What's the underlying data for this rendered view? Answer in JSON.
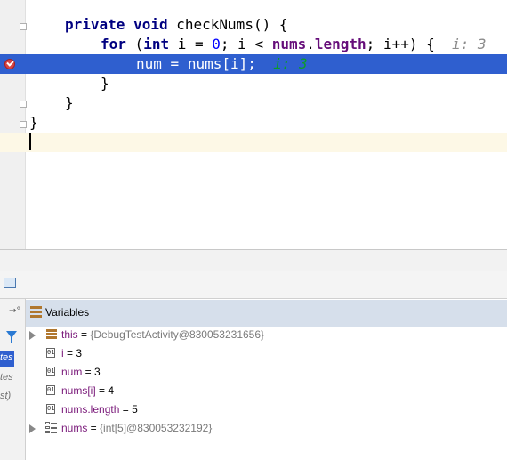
{
  "editor": {
    "lines": [
      {
        "kw1": "private",
        "kw2": "void",
        "rest": "checkNums() {"
      },
      {
        "kw1": "for",
        "open": "(",
        "kw2": "int",
        "pre": "i = ",
        "zero": "0",
        "mid": "; i < ",
        "field1": "nums",
        "dot": ".",
        "field2": "length",
        "end": "; i++) {",
        "hint": "i: 3"
      },
      {
        "field1": "num",
        "mid1": " = ",
        "field2": "nums",
        "bracket_open": "[",
        "index": "i",
        "bracket_close": "];",
        "hint": "i: 3"
      },
      {
        "text": "}"
      },
      {
        "text": "}"
      },
      {
        "text": "}"
      }
    ]
  },
  "variables_panel": {
    "title": "Variables",
    "restore_label": "→°",
    "side_labels": [
      "tes",
      "tes",
      "st)"
    ],
    "rows": [
      {
        "name": "this",
        "eq": " = ",
        "value": "{DebugTestActivity@830053231656}",
        "expandable": true,
        "icon": "object-icon"
      },
      {
        "name": "i",
        "eq": " = ",
        "value": "3",
        "expandable": false,
        "icon": "primitive-icon"
      },
      {
        "name": "num",
        "eq": " = ",
        "value": "3",
        "expandable": false,
        "icon": "primitive-icon"
      },
      {
        "name": "nums[i]",
        "eq": " = ",
        "value": "4",
        "expandable": false,
        "icon": "primitive-icon"
      },
      {
        "name": "nums.length",
        "eq": " = ",
        "value": "5",
        "expandable": false,
        "icon": "primitive-icon"
      },
      {
        "name": "nums",
        "eq": " = ",
        "value": "{int[5]@830053232192}",
        "expandable": true,
        "icon": "array-icon"
      }
    ]
  },
  "colors": {
    "selection": "#2f5fcf",
    "keyword": "#000080",
    "field": "#660e7a",
    "current_line": "#fdf8e6"
  }
}
